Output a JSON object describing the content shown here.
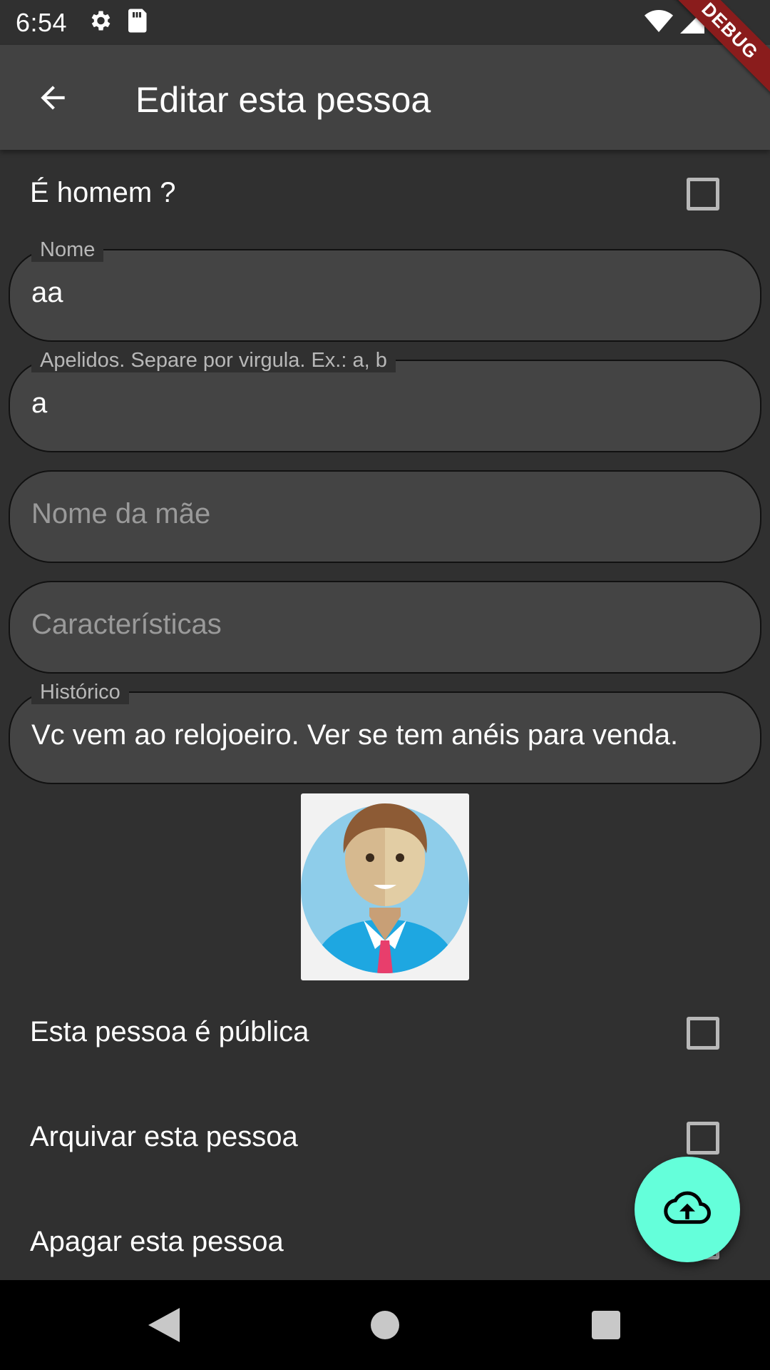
{
  "status_bar": {
    "time": "6:54",
    "icons_left": [
      "settings-icon",
      "sd-card-icon"
    ],
    "icons_right": [
      "wifi-icon",
      "signal-icon",
      "battery-icon"
    ],
    "debug_banner": "DEBUG"
  },
  "app_bar": {
    "title": "Editar esta pessoa",
    "back_icon": "arrow-back-icon",
    "background": "#424242"
  },
  "form": {
    "is_male": {
      "label": "É homem ?",
      "checked": false
    },
    "nome": {
      "label": "Nome",
      "value": "aa"
    },
    "apelidos": {
      "label": "Apelidos. Separe por virgula. Ex.: a, b",
      "value": "a"
    },
    "nome_mae": {
      "placeholder": "Nome da mãe",
      "value": ""
    },
    "caracteristicas": {
      "placeholder": "Características",
      "value": ""
    },
    "historico": {
      "label": "Histórico",
      "value": "Vc vem ao relojoeiro. Ver se tem anéis para venda."
    },
    "publica": {
      "label": "Esta pessoa é pública",
      "checked": false
    },
    "arquivar": {
      "label": "Arquivar esta pessoa",
      "checked": false
    },
    "apagar": {
      "label": "Apagar esta pessoa",
      "checked": false
    }
  },
  "avatar": {
    "icon": "person-avatar-icon"
  },
  "fab": {
    "icon": "cloud-upload-icon",
    "color": "#64ffda"
  },
  "nav_bar": {
    "icons": [
      "back-triangle-icon",
      "home-circle-icon",
      "recents-square-icon"
    ]
  },
  "colors": {
    "background": "#303030",
    "field_fill": "#444444",
    "label": "#b8b8b8",
    "accent": "#64ffda"
  }
}
